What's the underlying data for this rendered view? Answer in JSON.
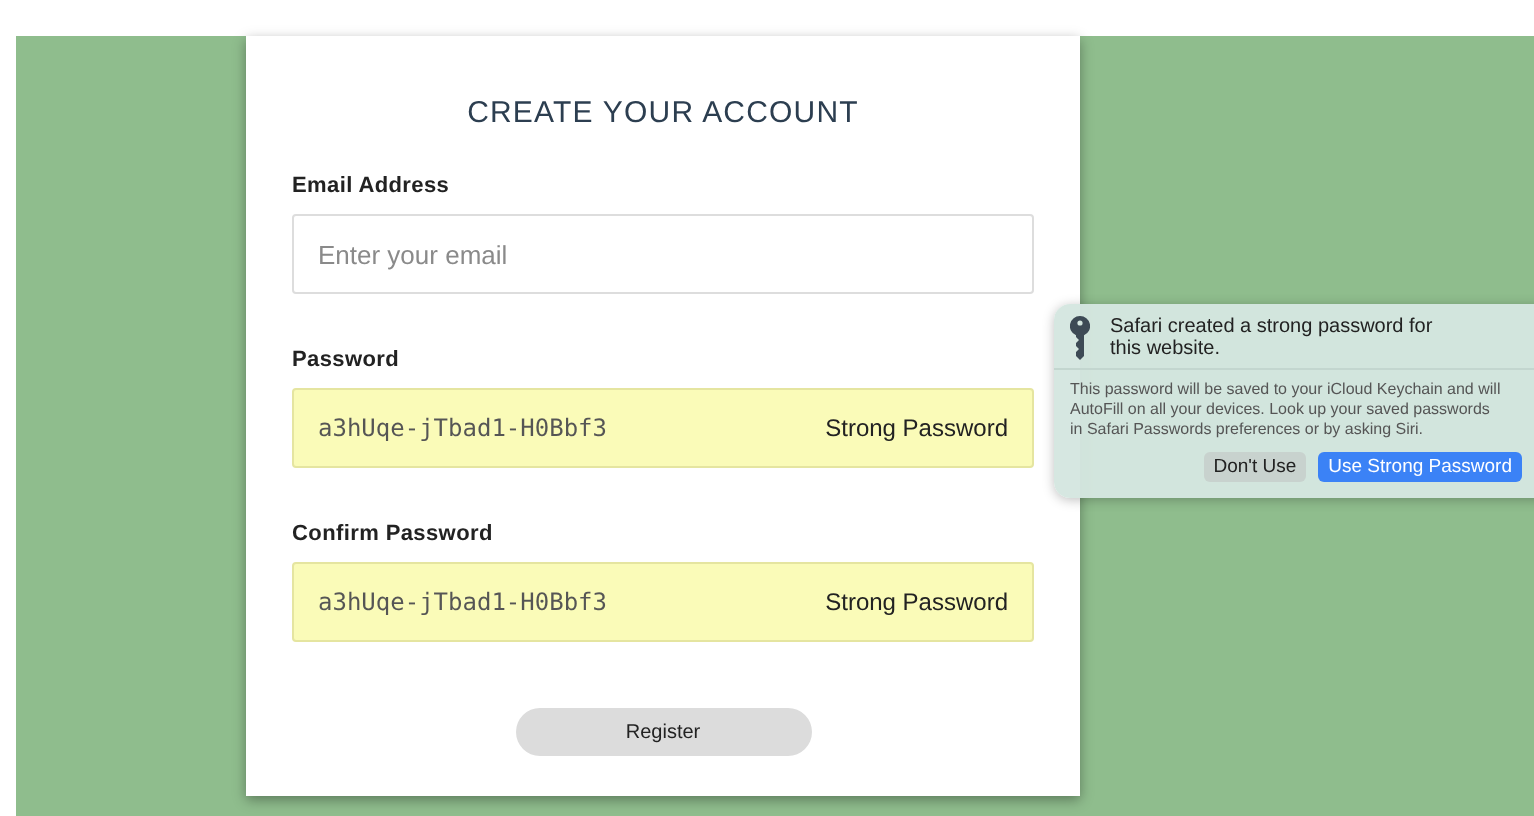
{
  "form": {
    "title": "CREATE YOUR ACCOUNT",
    "fields": [
      {
        "kind": "text",
        "label": "Email Address",
        "placeholder": "Enter your email"
      },
      {
        "kind": "generated",
        "label": "Password",
        "value": "a3hUqe-jTbad1-H0Bbf3",
        "badge": "Strong Password"
      },
      {
        "kind": "generated",
        "label": "Confirm Password",
        "value": "a3hUqe-jTbad1-H0Bbf3",
        "badge": "Strong Password"
      }
    ],
    "submit": "Register"
  },
  "popover": {
    "title": "Safari created a strong password for this website.",
    "body": "This password will be saved to your iCloud Keychain and will AutoFill on all your devices. Look up your saved passwords in Safari Passwords preferences or by asking Siri.",
    "buttons": [
      {
        "label": "Don't Use",
        "kind": "secondary"
      },
      {
        "label": "Use Strong Password",
        "kind": "primary"
      }
    ]
  }
}
